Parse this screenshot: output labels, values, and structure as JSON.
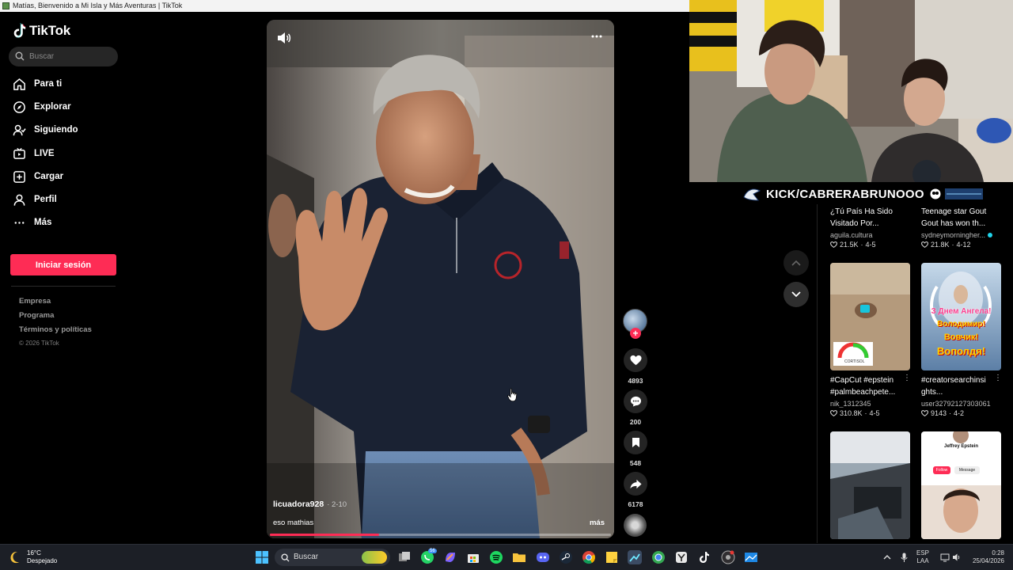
{
  "window": {
    "title": "Matías, Bienvenido a Mi Isla y Más Aventuras | TikTok"
  },
  "sidebar": {
    "logo_text": "TikTok",
    "search_placeholder": "Buscar",
    "nav": [
      {
        "label": "Para ti",
        "icon": "home-icon"
      },
      {
        "label": "Explorar",
        "icon": "compass-icon"
      },
      {
        "label": "Siguiendo",
        "icon": "following-icon"
      },
      {
        "label": "LIVE",
        "icon": "live-icon"
      },
      {
        "label": "Cargar",
        "icon": "upload-icon"
      },
      {
        "label": "Perfil",
        "icon": "profile-icon"
      },
      {
        "label": "Más",
        "icon": "more-icon"
      }
    ],
    "login_label": "Iniciar sesión",
    "footer_links": [
      "Empresa",
      "Programa",
      "Términos y políticas"
    ],
    "copyright": "© 2026 TikTok"
  },
  "video": {
    "author": "licuadora928",
    "date": "· 2-10",
    "caption": "eso mathias",
    "more_label": "más",
    "progress": 0.32
  },
  "actions": {
    "likes": "4893",
    "comments": "200",
    "saves": "548",
    "shares": "6178"
  },
  "overlay": {
    "kick_text": "KICK/CABRERABRUNOOO"
  },
  "related": [
    {
      "title": "¿Tú País Ha Sido Visitado Por...",
      "author": "aguila.cultura",
      "likes": "21.5K",
      "date": "4-5"
    },
    {
      "title": "Teenage star Gout Gout has won th...",
      "author": "sydneymorningher...",
      "likes": "21.8K",
      "date": "4-12"
    },
    {
      "title": "#CapCut #epstein #palmbeachpete...",
      "author": "nik_1312345",
      "likes": "310.8K",
      "date": "4-5"
    },
    {
      "title": "#creatorsearchinsi ghts...",
      "author": "user32792127303061",
      "likes": "9143",
      "date": "4-2"
    }
  ],
  "thumb_texts": {
    "cortisol": "CORTISOL",
    "angel_title": "З Днем Ангела!",
    "angel_name1": "Володимир!",
    "angel_name2": "Вовчик!",
    "angel_name3": "Вополдя!",
    "profile_name": "Jeffrey Epstein",
    "follow": "Follow",
    "message": "Message"
  },
  "taskbar": {
    "temp": "16°C",
    "weather": "Despejado",
    "search_label": "Buscar",
    "lang1": "ESP",
    "lang2": "LAA",
    "time": "0:28",
    "date": "25/04/2026",
    "whatsapp_badge": "56"
  },
  "colors": {
    "accent": "#fe2c55",
    "background": "#000000",
    "taskbar": "#1c1f26"
  }
}
